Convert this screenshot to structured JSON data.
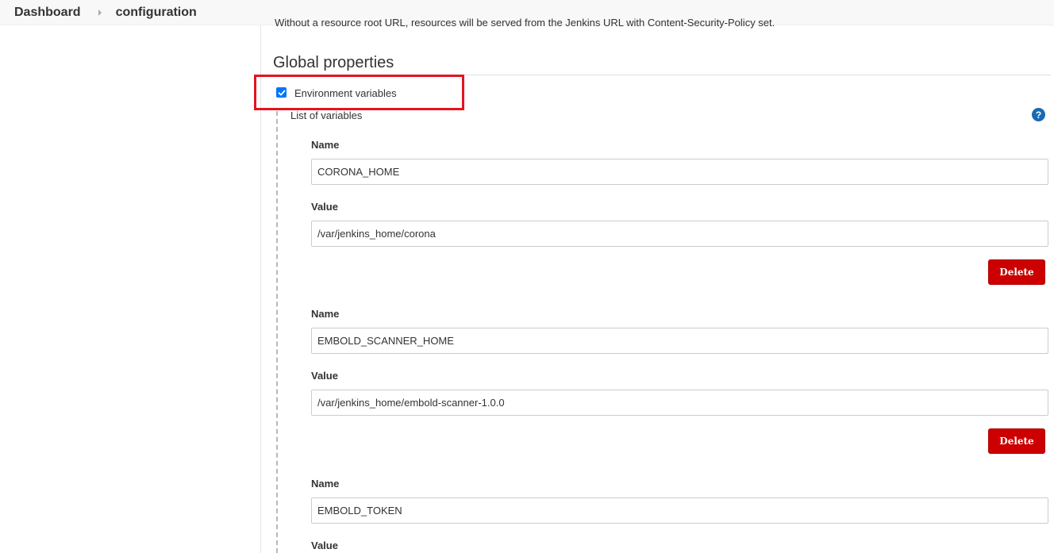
{
  "breadcrumb": {
    "items": [
      "Dashboard",
      "configuration"
    ]
  },
  "clipped_text": "Without a resource root URL, resources will be served from the Jenkins URL with Content-Security-Policy set.",
  "section": {
    "title": "Global properties"
  },
  "env_vars": {
    "checkbox_label": "Environment variables",
    "checked": true,
    "list_label": "List of variables",
    "help_symbol": "?",
    "name_label": "Name",
    "value_label": "Value",
    "delete_label": "Delete",
    "entries": [
      {
        "name": "CORONA_HOME",
        "value": "/var/jenkins_home/corona"
      },
      {
        "name": "EMBOLD_SCANNER_HOME",
        "value": "/var/jenkins_home/embold-scanner-1.0.0"
      },
      {
        "name": "EMBOLD_TOKEN",
        "value": ""
      }
    ]
  },
  "colors": {
    "highlight": "#e3141f",
    "delete_button": "#cc0000",
    "help_icon": "#1b6ab1",
    "checkbox": "#0075ff"
  }
}
